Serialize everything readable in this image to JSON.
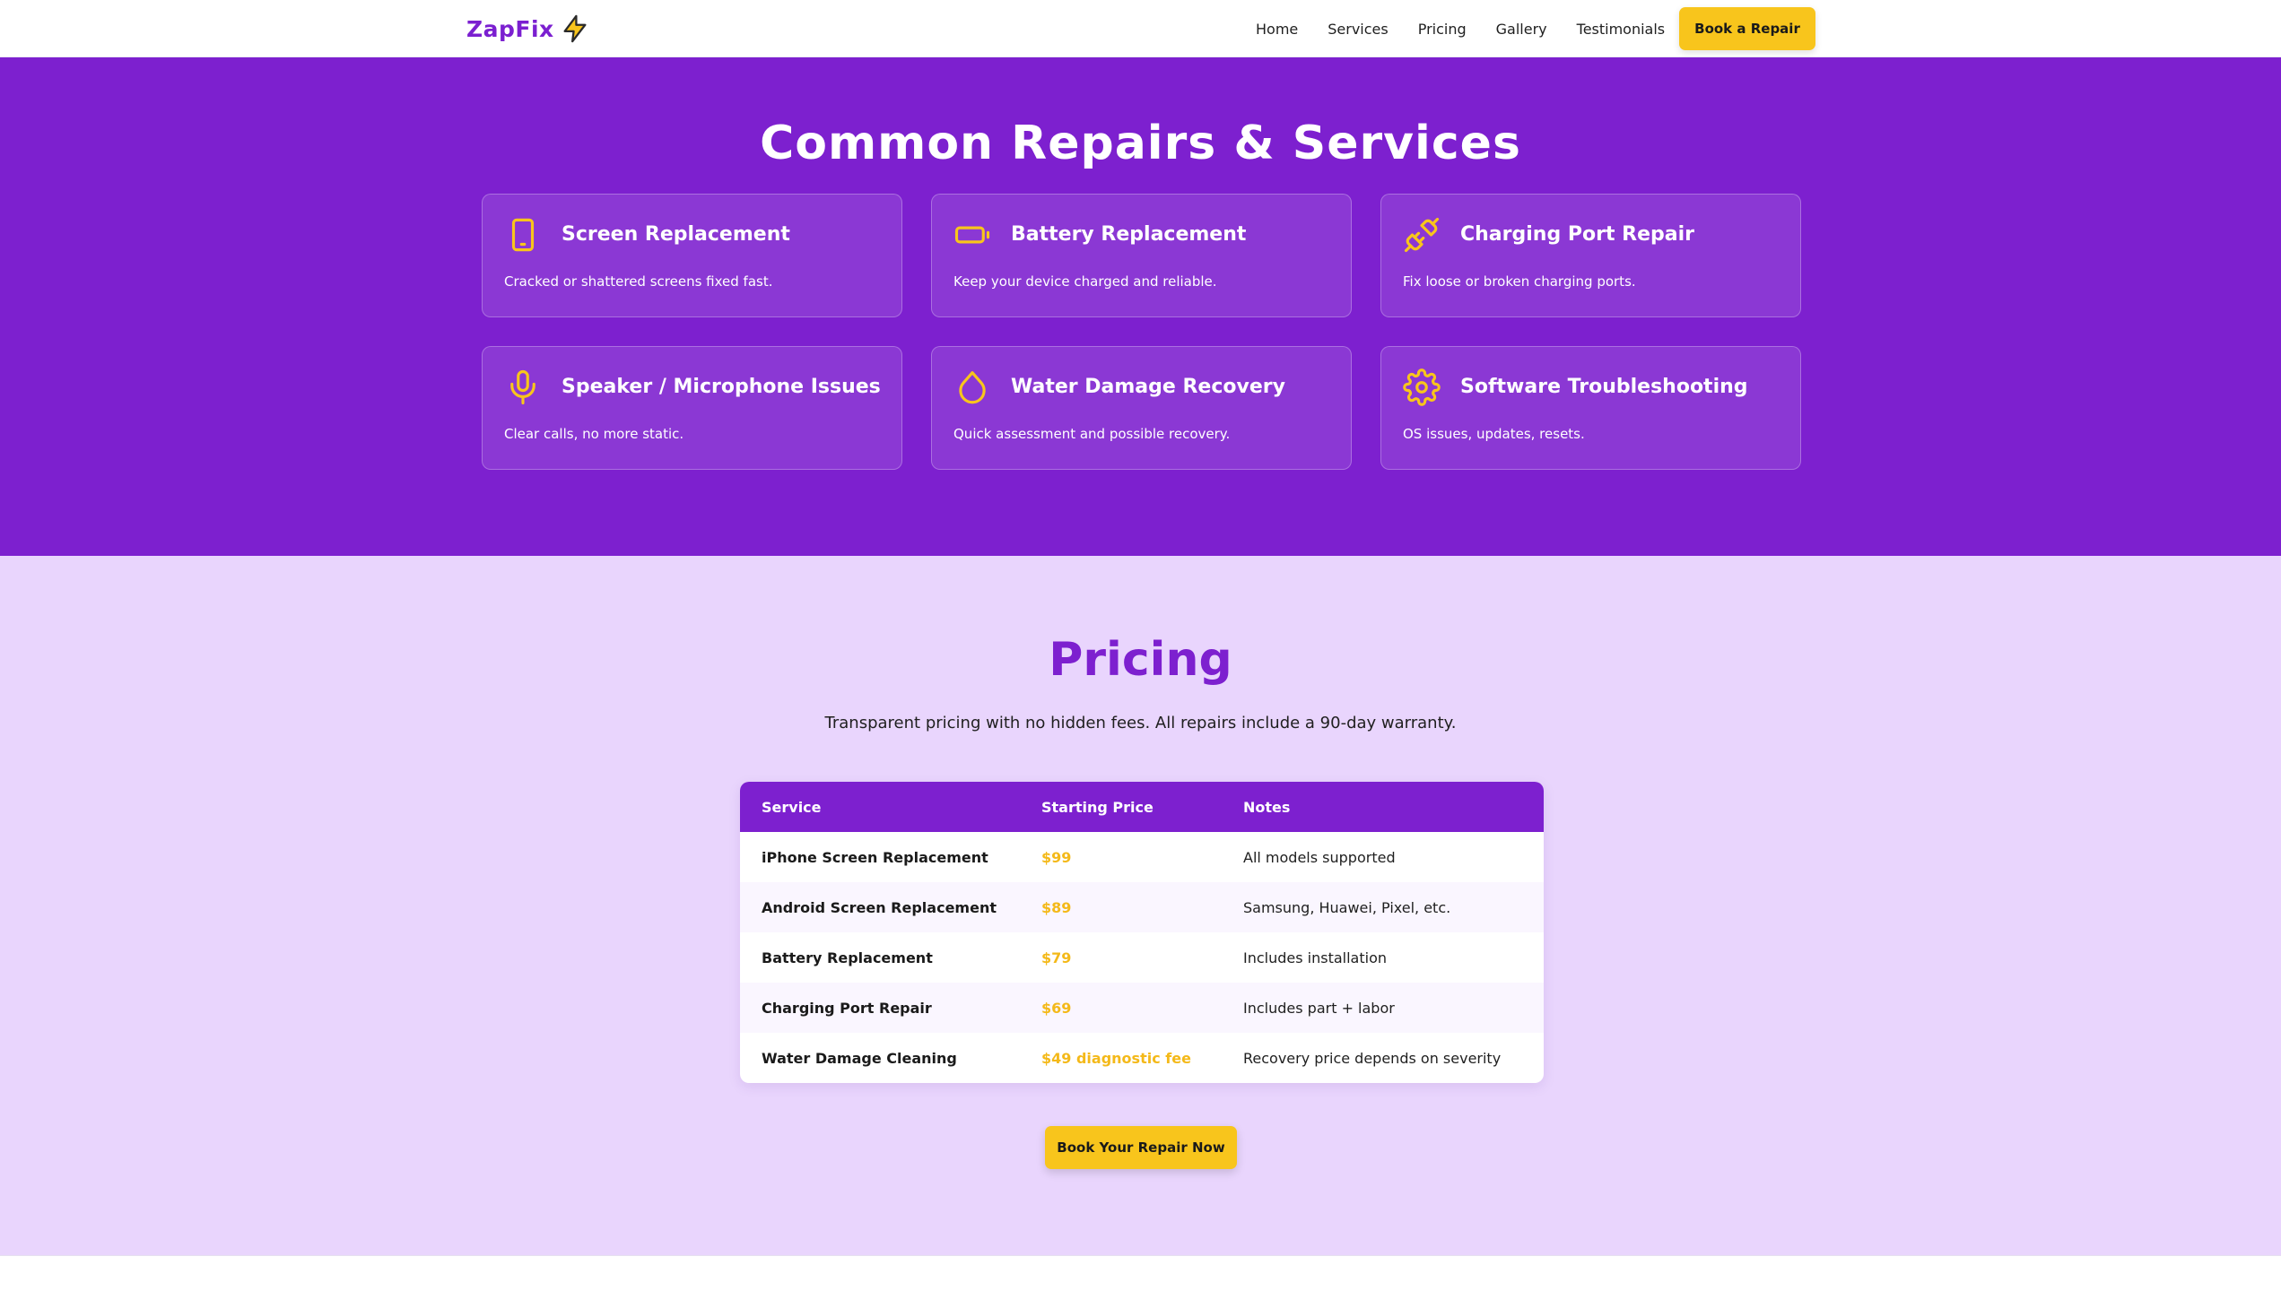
{
  "brand": {
    "name": "ZapFix"
  },
  "nav": {
    "links": [
      "Home",
      "Services",
      "Pricing",
      "Gallery",
      "Testimonials"
    ],
    "cta": "Book a Repair"
  },
  "services": {
    "title": "Common Repairs & Services",
    "cards": [
      {
        "icon": "phone-icon",
        "title": "Screen Replacement",
        "desc": "Cracked or shattered screens fixed fast."
      },
      {
        "icon": "battery-icon",
        "title": "Battery Replacement",
        "desc": "Keep your device charged and reliable."
      },
      {
        "icon": "plug-icon",
        "title": "Charging Port Repair",
        "desc": "Fix loose or broken charging ports."
      },
      {
        "icon": "microphone-icon",
        "title": "Speaker / Microphone Issues",
        "desc": "Clear calls, no more static."
      },
      {
        "icon": "droplet-icon",
        "title": "Water Damage Recovery",
        "desc": "Quick assessment and possible recovery."
      },
      {
        "icon": "gear-icon",
        "title": "Software Troubleshooting",
        "desc": "OS issues, updates, resets."
      }
    ]
  },
  "pricing": {
    "title": "Pricing",
    "subtitle": "Transparent pricing with no hidden fees. All repairs include a 90-day warranty.",
    "headers": [
      "Service",
      "Starting Price",
      "Notes"
    ],
    "rows": [
      {
        "service": "iPhone Screen Replacement",
        "price": "$99",
        "notes": "All models supported"
      },
      {
        "service": "Android Screen Replacement",
        "price": "$89",
        "notes": "Samsung, Huawei, Pixel, etc."
      },
      {
        "service": "Battery Replacement",
        "price": "$79",
        "notes": "Includes installation"
      },
      {
        "service": "Charging Port Repair",
        "price": "$69",
        "notes": "Includes part + labor"
      },
      {
        "service": "Water Damage Cleaning",
        "price": "$49 diagnostic fee",
        "notes": "Recovery price depends on severity"
      }
    ],
    "cta": "Book Your Repair Now"
  },
  "colors": {
    "primary": "#7d20cf",
    "accent": "#f8c51c",
    "light": "#e9d5fd"
  }
}
